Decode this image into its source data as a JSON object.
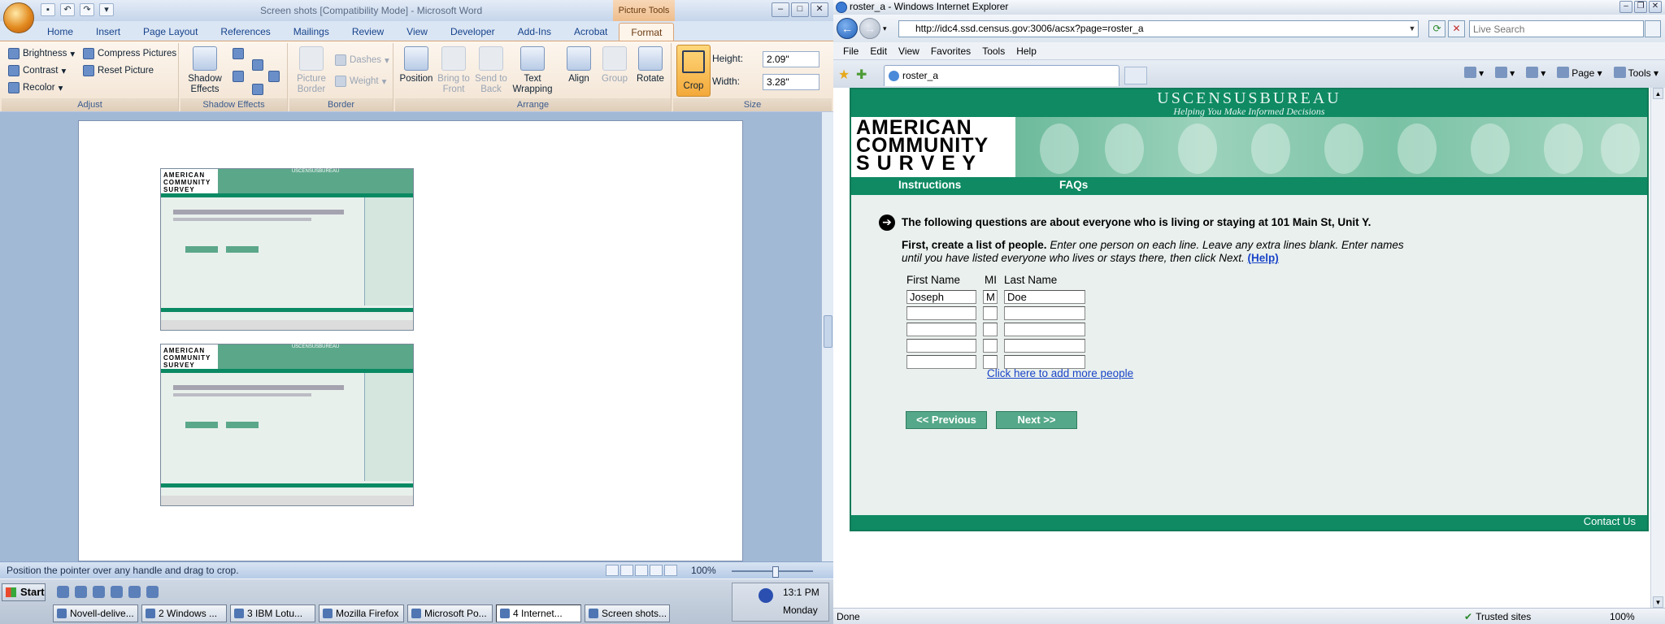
{
  "word": {
    "title": "Screen shots [Compatibility Mode] - Microsoft Word",
    "context_tab": "Picture Tools",
    "tabs": [
      "Home",
      "Insert",
      "Page Layout",
      "References",
      "Mailings",
      "Review",
      "View",
      "Developer",
      "Add-Ins",
      "Acrobat",
      "Format"
    ],
    "active_tab": "Format",
    "adjust": {
      "label": "Adjust",
      "brightness": "Brightness",
      "contrast": "Contrast",
      "recolor": "Recolor",
      "compress": "Compress Pictures",
      "reset": "Reset Picture"
    },
    "shadow": {
      "label": "Shadow Effects",
      "button": "Shadow Effects"
    },
    "border": {
      "label": "Border",
      "picture_border": "Picture Border",
      "dashes": "Dashes",
      "weight": "Weight"
    },
    "arrange": {
      "label": "Arrange",
      "position": "Position",
      "bring_to_front": "Bring to Front",
      "send_to_back": "Send to Back",
      "text_wrapping": "Text Wrapping",
      "align": "Align",
      "group": "Group",
      "rotate": "Rotate"
    },
    "size": {
      "label": "Size",
      "crop": "Crop",
      "height_label": "Height:",
      "height": "2.09\"",
      "width_label": "Width:",
      "width": "3.28\""
    },
    "status": "Position the pointer over any handle and drag to crop.",
    "zoom": "100%"
  },
  "ie": {
    "title": "roster_a - Windows Internet Explorer",
    "url": "http://idc4.ssd.census.gov:3006/acsx?page=roster_a",
    "search_placeholder": "Live Search",
    "menu": [
      "File",
      "Edit",
      "View",
      "Favorites",
      "Tools",
      "Help"
    ],
    "tab": "roster_a",
    "cmd": {
      "page": "Page",
      "tools": "Tools"
    },
    "status": "Done",
    "zone": "Trusted sites",
    "zoom": "100%"
  },
  "acs": {
    "bureau": "USCENSUSBUREAU",
    "tagline": "Helping You Make Informed Decisions",
    "logo": [
      "AMERICAN",
      "COMMUNITY",
      "S U R V E Y"
    ],
    "nav": {
      "instructions": "Instructions",
      "faqs": "FAQs"
    },
    "question": "The following questions are about everyone who is living or staying at 101 Main St, Unit Y.",
    "instr_bold": "First, create a list of people.",
    "instr_italic": " Enter one person on each line. Leave any extra lines blank. Enter names until you have listed everyone who lives or stays there, then click Next.",
    "help": "(Help)",
    "columns": {
      "first": "First Name",
      "mi": "MI",
      "last": "Last Name"
    },
    "rows": [
      {
        "first": "Joseph",
        "mi": "M",
        "last": "Doe"
      },
      {
        "first": "",
        "mi": "",
        "last": ""
      },
      {
        "first": "",
        "mi": "",
        "last": ""
      },
      {
        "first": "",
        "mi": "",
        "last": ""
      },
      {
        "first": "",
        "mi": "",
        "last": ""
      }
    ],
    "add_more": "Click here to add more people",
    "previous": "<<  Previous",
    "next": "Next  >>",
    "contact": "Contact Us"
  },
  "thumbnails": {
    "logo": [
      "AMERICAN",
      "COMMUNITY",
      "SURVEY"
    ],
    "bureau": "USCENSUSBUREAU"
  },
  "taskbar": {
    "start": "Start",
    "tasks": [
      "Novell-delive...",
      "2 Windows ...",
      "3 IBM Lotu...",
      "Mozilla Firefox",
      "Microsoft Po...",
      "4 Internet...",
      "Screen shots..."
    ],
    "active_task": 5,
    "time": "13:1 PM",
    "day": "Monday"
  },
  "colors": {
    "census_green": "#0f8a63",
    "button_green": "#55a889",
    "link_blue": "#1a44c8"
  }
}
